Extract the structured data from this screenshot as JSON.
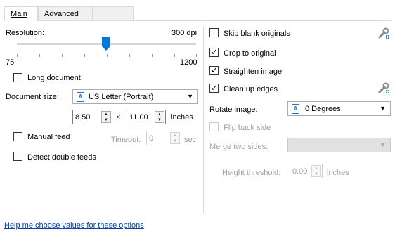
{
  "tabs": [
    {
      "label": "Main",
      "active": true
    },
    {
      "label": "Advanced",
      "active": false
    }
  ],
  "left": {
    "resolution_label": "Resolution:",
    "resolution_value": "300 dpi",
    "slider_min": "75",
    "slider_max": "1200",
    "long_document_label": "Long document",
    "long_document_checked": false,
    "document_size_label": "Document size:",
    "document_size_value": "US Letter (Portrait)",
    "width_value": "8.50",
    "times": "×",
    "height_value": "11.00",
    "units": "inches",
    "manual_feed_label": "Manual feed",
    "timeout_label": "Timeout:",
    "timeout_value": "0",
    "timeout_unit": "sec",
    "detect_double_label": "Detect double feeds"
  },
  "right": {
    "skip_blank_label": "Skip blank originals",
    "crop_label": "Crop to original",
    "straighten_label": "Straighten image",
    "clean_edges_label": "Clean up edges",
    "rotate_label": "Rotate image:",
    "rotate_value": "0 Degrees",
    "flip_label": "Flip back side",
    "merge_label": "Merge two sides:",
    "merge_value": "",
    "height_threshold_label": "Height threshold:",
    "height_threshold_value": "0.00",
    "height_threshold_unit": "inches"
  },
  "help_link": "Help me choose values for these options",
  "colors": {
    "accent": "#0078d7",
    "link": "#0645ad"
  }
}
